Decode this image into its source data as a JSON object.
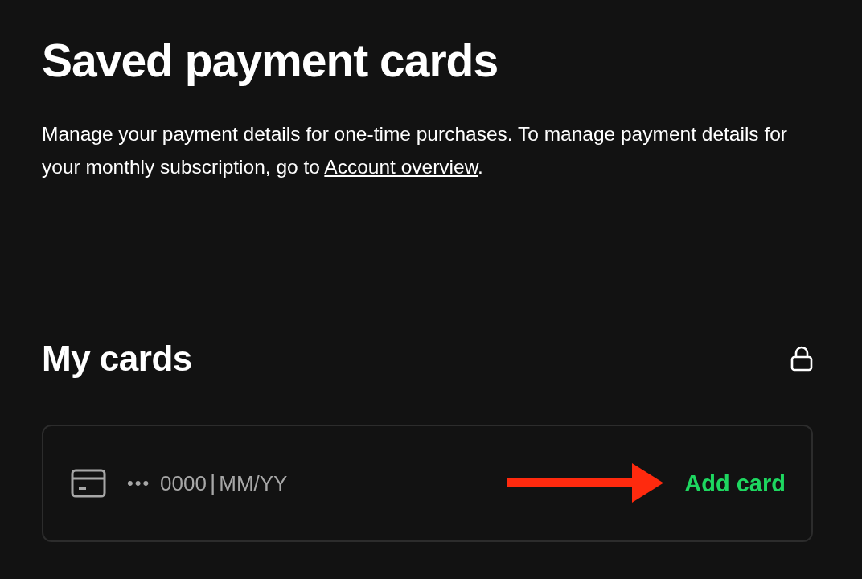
{
  "title": "Saved payment cards",
  "description": {
    "text": "Manage your payment details for one-time purchases. To manage payment details for your monthly subscription, go to ",
    "link": "Account overview",
    "after": "."
  },
  "section": {
    "title": "My cards",
    "locked": true
  },
  "card": {
    "dots": "•••",
    "number": "0000",
    "separator": "|",
    "expiry": "MM/YY",
    "action": "Add card"
  },
  "annotation": {
    "kind": "arrow",
    "color": "#ff2a0e"
  }
}
